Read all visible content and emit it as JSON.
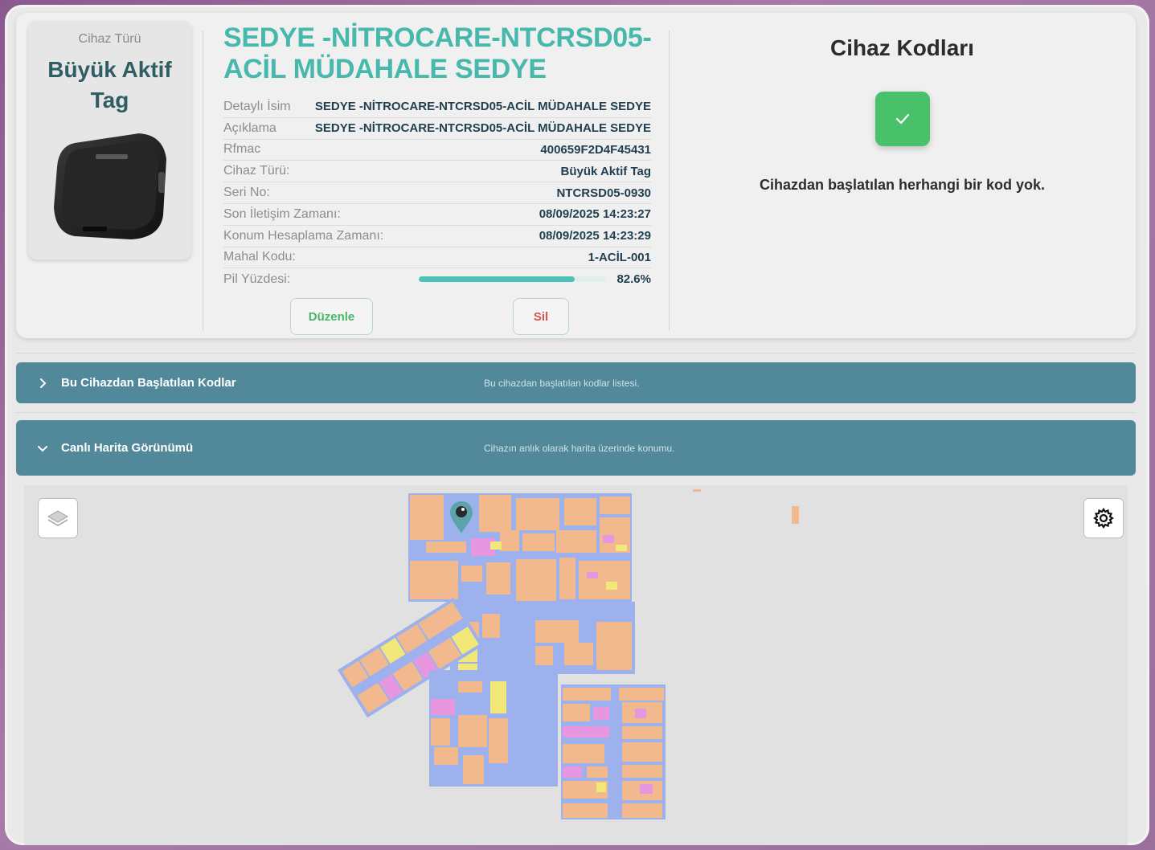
{
  "device_type": {
    "label": "Cihaz Türü",
    "name": "Büyük Aktif Tag",
    "image_icon": "tag-device-icon"
  },
  "device": {
    "title": "SEDYE -NİTROCARE-NTCRSD05-ACİL MÜDAHALE SEDYE",
    "fields": [
      {
        "key": "Detaylı İsim",
        "value": "SEDYE -NİTROCARE-NTCRSD05-ACİL MÜDAHALE SEDYE"
      },
      {
        "key": "Açıklama",
        "value": "SEDYE -NİTROCARE-NTCRSD05-ACİL MÜDAHALE SEDYE"
      },
      {
        "key": "Rfmac",
        "value": "400659F2D4F45431"
      },
      {
        "key": "Cihaz Türü:",
        "value": "Büyük Aktif Tag"
      },
      {
        "key": "Seri No:",
        "value": "NTCRSD05-0930"
      },
      {
        "key": "Son İletişim Zamanı:",
        "value": "08/09/2025 14:23:27"
      },
      {
        "key": "Konum Hesaplama Zamanı:",
        "value": "08/09/2025 14:23:29"
      },
      {
        "key": "Mahal Kodu:",
        "value": "1-ACİL-001"
      }
    ],
    "battery": {
      "key": "Pil Yüzdesi:",
      "value_text": "82.6%",
      "percent": 82.6,
      "color": "#4ec1b9"
    },
    "edit_label": "Düzenle",
    "delete_label": "Sil"
  },
  "codes": {
    "title": "Cihaz Kodları",
    "status_icon": "check-icon",
    "message": "Cihazdan başlatılan herhangi bir kod yok."
  },
  "sections": [
    {
      "title": "Bu Cihazdan Başlatılan Kodlar",
      "description": "Bu cihazdan başlatılan kodlar listesi.",
      "icon": "chevron-right-icon",
      "expanded": false
    },
    {
      "title": "Canlı Harita Görünümü",
      "description": "Cihazın anlık olarak harita üzerinde konumu.",
      "icon": "chevron-down-icon",
      "expanded": true
    }
  ],
  "map": {
    "layers_icon": "layers-icon",
    "settings_icon": "gear-icon",
    "marker_icon": "location-pin-icon",
    "colors": {
      "room": "#f2b98f",
      "corridor": "#9db2ec",
      "special": "#e697e0",
      "yellow": "#f2e87a",
      "accent": "#52899a"
    }
  }
}
